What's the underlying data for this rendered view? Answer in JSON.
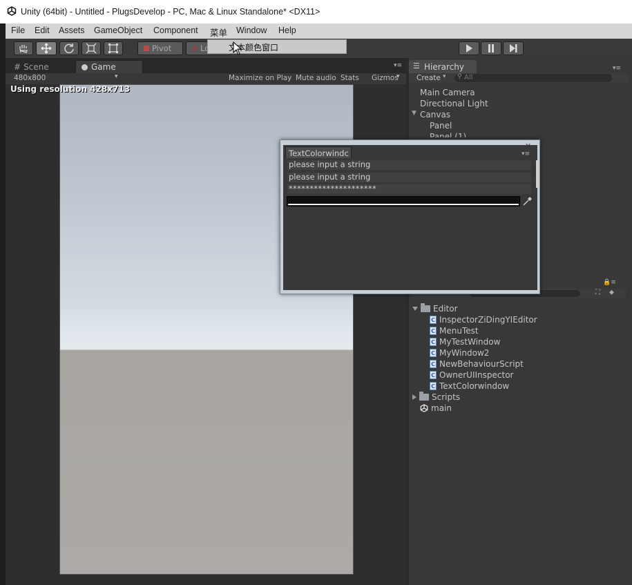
{
  "window": {
    "title": "Unity (64bit) - Untitled - PlugsDevelop - PC, Mac & Linux Standalone* <DX11>"
  },
  "menu": [
    "File",
    "Edit",
    "Assets",
    "GameObject",
    "Component",
    "菜单",
    "Window",
    "Help"
  ],
  "toolbar": {
    "tools": [
      "hand-icon",
      "move-icon",
      "rotate-icon",
      "scale-icon",
      "rect-icon"
    ],
    "pivot_label": "Pivot",
    "local_label": "Local",
    "tooltip": "文本颜色窗口",
    "play": [
      "play-icon",
      "pause-icon",
      "step-icon"
    ]
  },
  "scene_tab": "Scene",
  "game_tab": "Game",
  "game_bar": {
    "aspect": "480x800",
    "maximize": "Maximize on Play",
    "mute": "Mute audio",
    "stats": "Stats",
    "gizmos": "Gizmos"
  },
  "game_view": {
    "resolution_label": "Using resolution 428x713"
  },
  "hierarchy": {
    "tab": "Hierarchy",
    "create": "Create",
    "search_placeholder": "All",
    "items": [
      "Main Camera",
      "Directional Light",
      "Canvas",
      "Panel",
      "Panel (1)"
    ]
  },
  "project": {
    "folders": [
      "Editor",
      "Scripts"
    ],
    "editor_files": [
      "InspectorZiDingYIEditor",
      "MenuTest",
      "MyTestWindow",
      "MyWindow2",
      "NewBehaviourScript",
      "OwnerUIInspector",
      "TextColorwindow"
    ],
    "scene": "main"
  },
  "text_color_window": {
    "tab": "TextColorwindc",
    "field1": "please input a string",
    "field2": "please input a string",
    "password": "*********************",
    "color": "#ffffff"
  },
  "colors": {
    "accent": "#4a90e2",
    "panel": "#383838"
  }
}
